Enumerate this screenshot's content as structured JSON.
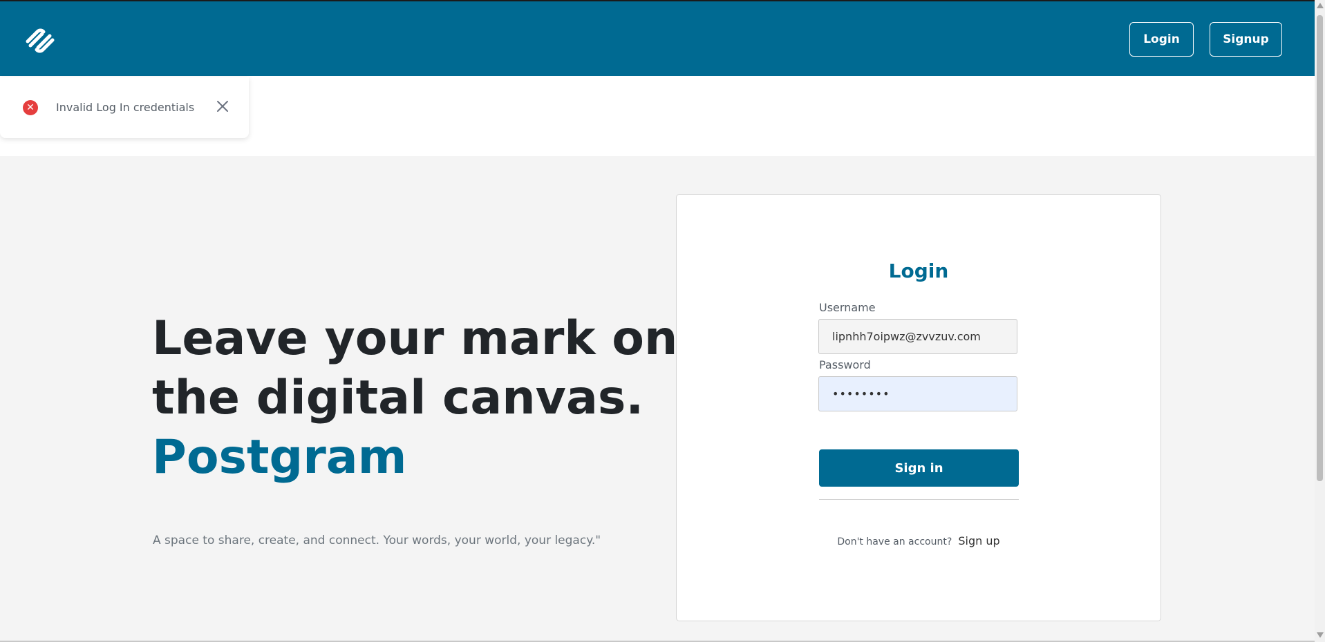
{
  "header": {
    "logo_icon": "squarespace-logo-icon",
    "login_label": "Login",
    "signup_label": "Signup",
    "background_color": "#006a92"
  },
  "toast": {
    "icon": "error-circle-icon",
    "message": "Invalid Log In credentials",
    "close_icon": "close-icon",
    "status_color": "#e53e3e"
  },
  "hero": {
    "title_line1": "Leave your mark on",
    "title_line2": "the digital canvas.",
    "brand": "Postgram",
    "subtitle": "A space to share, create, and connect. Your words, your world, your legacy.\""
  },
  "login_form": {
    "title": "Login",
    "username_label": "Username",
    "username_value": "lipnhh7oipwz@zvvzuv.com",
    "password_label": "Password",
    "password_value": "••••••••",
    "submit_label": "Sign in",
    "signup_prompt": "Don't have an account?",
    "signup_link": "Sign up",
    "accent_color": "#006a92"
  }
}
